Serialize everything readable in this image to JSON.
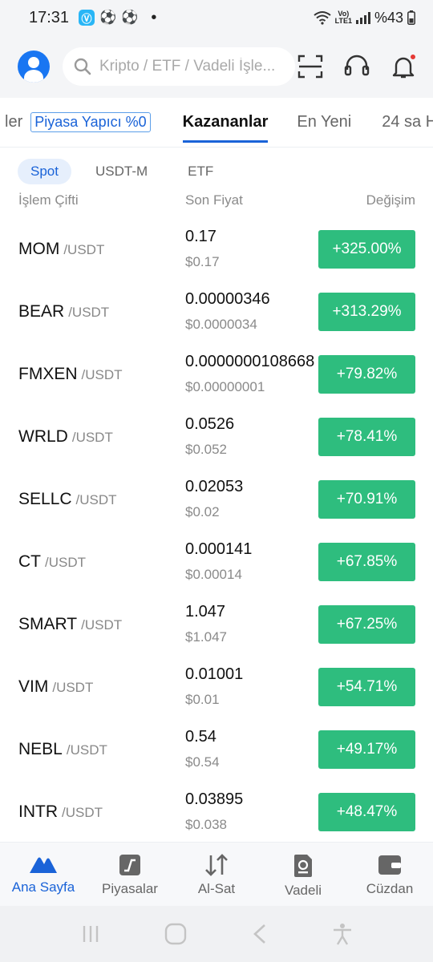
{
  "status_bar": {
    "time": "17:31",
    "app_badge": "Ⓥ",
    "network_label_top": "Vo)",
    "network_label_bottom": "LTE1",
    "battery": "%43"
  },
  "header": {
    "search_placeholder": "Kripto / ETF / Vadeli İşle..."
  },
  "category_tabs": [
    {
      "label": "ler"
    },
    {
      "label": "Piyasa Yapıcı %0"
    },
    {
      "label": "Kazananlar"
    },
    {
      "label": "En Yeni"
    },
    {
      "label": "24 sa Ha"
    }
  ],
  "sub_tabs": [
    {
      "label": "Spot"
    },
    {
      "label": "USDT-M"
    },
    {
      "label": "ETF"
    }
  ],
  "columns": {
    "pair": "İşlem Çifti",
    "price": "Son Fiyat",
    "change": "Değişim"
  },
  "rows": [
    {
      "base": "MOM",
      "quote": "/USDT",
      "price": "0.17",
      "price_usd": "$0.17",
      "change": "+325.00%"
    },
    {
      "base": "BEAR",
      "quote": "/USDT",
      "price": "0.00000346",
      "price_usd": "$0.0000034",
      "change": "+313.29%"
    },
    {
      "base": "FMXEN",
      "quote": "/USDT",
      "price": "0.0000000108668",
      "price_usd": "$0.00000001",
      "change": "+79.82%"
    },
    {
      "base": "WRLD",
      "quote": "/USDT",
      "price": "0.0526",
      "price_usd": "$0.052",
      "change": "+78.41%"
    },
    {
      "base": "SELLC",
      "quote": "/USDT",
      "price": "0.02053",
      "price_usd": "$0.02",
      "change": "+70.91%"
    },
    {
      "base": "CT",
      "quote": "/USDT",
      "price": "0.000141",
      "price_usd": "$0.00014",
      "change": "+67.85%"
    },
    {
      "base": "SMART",
      "quote": "/USDT",
      "price": "1.047",
      "price_usd": "$1.047",
      "change": "+67.25%"
    },
    {
      "base": "VIM",
      "quote": "/USDT",
      "price": "0.01001",
      "price_usd": "$0.01",
      "change": "+54.71%"
    },
    {
      "base": "NEBL",
      "quote": "/USDT",
      "price": "0.54",
      "price_usd": "$0.54",
      "change": "+49.17%"
    },
    {
      "base": "INTR",
      "quote": "/USDT",
      "price": "0.03895",
      "price_usd": "$0.038",
      "change": "+48.47%"
    }
  ],
  "bottom_nav": [
    {
      "label": "Ana Sayfa",
      "icon": "home-mountain-icon"
    },
    {
      "label": "Piyasalar",
      "icon": "markets-icon"
    },
    {
      "label": "Al-Sat",
      "icon": "trade-arrows-icon"
    },
    {
      "label": "Vadeli",
      "icon": "futures-icon"
    },
    {
      "label": "Cüzdan",
      "icon": "wallet-icon"
    }
  ],
  "colors": {
    "accent": "#1a63d8",
    "positive": "#2ebd7e",
    "background": "#f4f5f7"
  }
}
